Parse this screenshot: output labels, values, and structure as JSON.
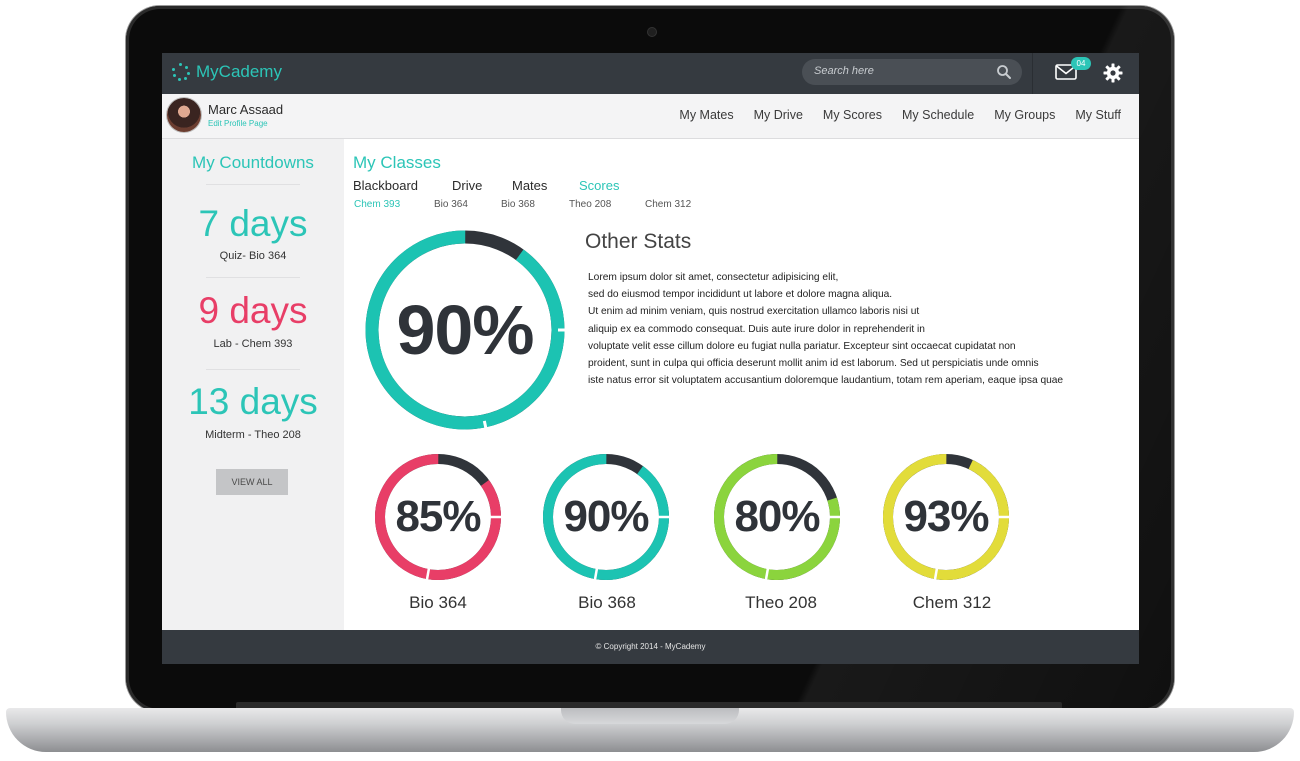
{
  "app": {
    "name": "MyCademy"
  },
  "topbar": {
    "search_placeholder": "Search here",
    "mail_badge": "04",
    "icons": [
      "logo-dots-icon",
      "search-icon",
      "mail-icon",
      "gear-icon"
    ]
  },
  "profile": {
    "name": "Marc Assaad",
    "edit_link": "Edit Profile Page"
  },
  "nav": {
    "items": [
      "My Mates",
      "My Drive",
      "My Scores",
      "My Schedule",
      "My Groups",
      "My Stuff"
    ]
  },
  "sidebar": {
    "title": "My Countdowns",
    "countdowns": [
      {
        "days": "7 days",
        "label": "Quiz- Bio 364",
        "color": "#2cc5b7"
      },
      {
        "days": "9 days",
        "label": "Lab - Chem 393",
        "color": "#e83e67"
      },
      {
        "days": "13 days",
        "label": "Midterm - Theo 208",
        "color": "#2cc5b7"
      }
    ],
    "view_all": "VIEW ALL"
  },
  "main": {
    "title": "My Classes",
    "tabs": [
      "Blackboard",
      "Drive",
      "Mates",
      "Scores"
    ],
    "active_tab": "Scores",
    "subtabs": [
      "Chem 393",
      "Bio 364",
      "Bio 368",
      "Theo 208",
      "Chem 312"
    ],
    "active_subtab": "Chem 393",
    "big_score": {
      "percent": 90,
      "label": "90%",
      "color": "#1cc3b2"
    },
    "stats_title": "Other Stats",
    "stats_lines": [
      "Lorem ipsum dolor sit amet, consectetur adipisicing elit,",
      "sed do eiusmod tempor incididunt ut labore et dolore magna aliqua.",
      "Ut enim ad minim veniam, quis nostrud exercitation ullamco laboris nisi ut",
      "aliquip ex ea commodo consequat. Duis aute irure dolor in reprehenderit in",
      "voluptate velit esse cillum dolore eu fugiat nulla pariatur. Excepteur sint occaecat cupidatat non",
      "proident, sunt in culpa qui officia deserunt mollit anim id est laborum. Sed ut perspiciatis unde omnis",
      "iste natus error sit voluptatem accusantium doloremque laudantium, totam rem aperiam, eaque ipsa quae"
    ],
    "scores": [
      {
        "label": "Bio 364",
        "pct_label": "85%",
        "percent": 85,
        "color": "#e83e67"
      },
      {
        "label": "Bio 368",
        "pct_label": "90%",
        "percent": 90,
        "color": "#1cc3b2"
      },
      {
        "label": "Theo 208",
        "pct_label": "80%",
        "percent": 80,
        "color": "#8bd43d"
      },
      {
        "label": "Chem 312",
        "pct_label": "93%",
        "percent": 93,
        "color": "#e2dc3a"
      }
    ]
  },
  "footer": {
    "copyright": "© Copyright 2014 - MyCademy"
  },
  "colors": {
    "accent": "#2cc5b7",
    "dark": "#353a40",
    "track": "#30343a"
  }
}
